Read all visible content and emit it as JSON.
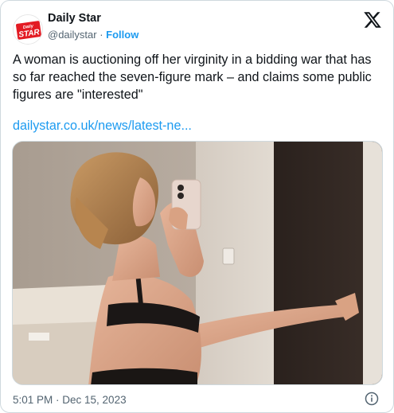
{
  "author": {
    "name": "Daily Star",
    "handle": "@dailystar",
    "separator": " · ",
    "follow_label": "Follow",
    "avatar_logo": {
      "line1": "Daily",
      "line2": "STAR",
      "bg_color": "#e31b23"
    }
  },
  "tweet": {
    "text": "A woman is auctioning off her virginity in a bidding war that has so far reached the seven-figure mark – and claims some public figures are \"interested\"",
    "link": "dailystar.co.uk/news/latest-ne..."
  },
  "footer": {
    "timestamp": "5:01 PM · Dec 15, 2023"
  },
  "icons": {
    "brand": "x-logo-icon",
    "info": "info-icon"
  },
  "colors": {
    "accent": "#1d9bf0",
    "secondary_text": "#536471",
    "primary_text": "#0f1419",
    "border": "#cfd9de"
  }
}
